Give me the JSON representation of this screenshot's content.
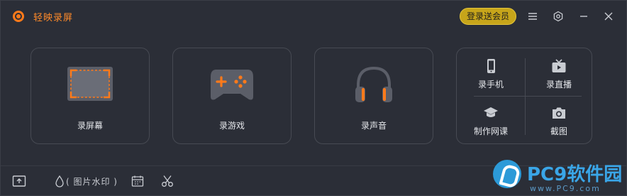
{
  "app": {
    "title": "轻映录屏",
    "login_button": "登录送会员"
  },
  "titlebar_icons": [
    "menu-icon",
    "settings-icon",
    "minimize-icon",
    "close-icon"
  ],
  "cards": [
    {
      "id": "screen",
      "label": "录屏幕",
      "icon": "screen-record-icon"
    },
    {
      "id": "game",
      "label": "录游戏",
      "icon": "gamepad-icon"
    },
    {
      "id": "audio",
      "label": "录声音",
      "icon": "headphones-icon"
    }
  ],
  "multi_card": {
    "items": [
      {
        "id": "phone",
        "label": "录手机",
        "icon": "phone-icon"
      },
      {
        "id": "live",
        "label": "录直播",
        "icon": "tv-icon"
      },
      {
        "id": "course",
        "label": "制作网课",
        "icon": "graduation-cap-icon"
      },
      {
        "id": "screenshot",
        "label": "截图",
        "icon": "camera-icon"
      }
    ]
  },
  "bottombar": {
    "watermark_label": "( 图片水印 )",
    "icons": [
      "folder-icon",
      "watermark-icon",
      "schedule-icon",
      "scissors-icon"
    ]
  },
  "watermark_brand": {
    "name": "PC9软件园",
    "url": "www.PC9.com"
  },
  "colors": {
    "accent": "#ff7a1a",
    "background": "#2b2e37",
    "card_border": "#474a53",
    "login_button": "#c7a51a",
    "brand_blue": "#3aa6e8"
  }
}
